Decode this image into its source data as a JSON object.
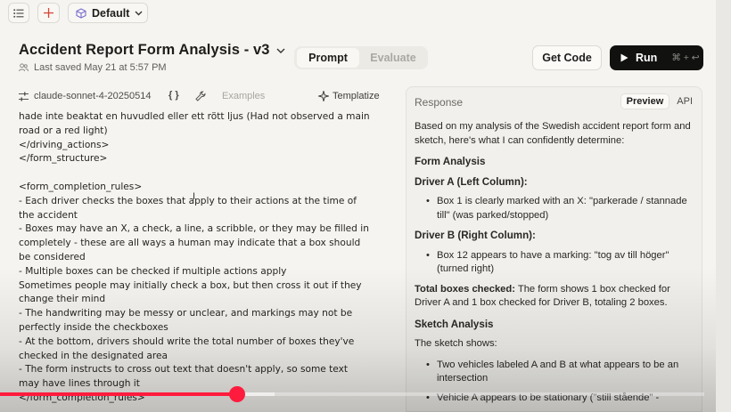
{
  "workspace": {
    "name": "Default"
  },
  "document": {
    "title": "Accident Report Form Analysis - v3",
    "last_saved": "Last saved May 21 at 5:57 PM"
  },
  "modes": {
    "prompt": "Prompt",
    "evaluate": "Evaluate"
  },
  "actions": {
    "get_code": "Get Code",
    "run": "Run",
    "run_shortcut": "⌘ + ↩"
  },
  "prompt_toolbar": {
    "model": "claude-sonnet-4-20250514",
    "variables_symbol": "{ }",
    "examples": "Examples",
    "templatize": "Templatize"
  },
  "prompt_lines": [
    "hade inte beaktat en huvudled eller ett rött ljus (Had not observed a main",
    "road or a red light)",
    "</driving_actions>",
    "</form_structure>",
    "",
    "<form_completion_rules>",
    "- Each driver checks the boxes that apply to their actions at the time of",
    "the accident",
    "- Boxes may have an X, a check, a line, a scribble, or they may be filled in",
    "completely - these are all ways a human may indicate that a box should",
    "be considered",
    "- Multiple boxes can be checked if multiple actions apply",
    "Sometimes people may initially check a box, but then cross it out if they",
    "change their mind",
    "- The handwriting may be messy or unclear, and markings may not be",
    "perfectly inside the checkboxes",
    "- At the bottom, drivers should write the total number of boxes they've",
    "checked in the designated area",
    "- The form instructs to cross out text that doesn't apply, so some text",
    "may have lines through it",
    "</form_completion_rules>"
  ],
  "response": {
    "header": "Response",
    "tab_preview": "Preview",
    "tab_api": "API",
    "intro": "Based on my analysis of the Swedish accident report form and sketch, here's what I can confidently determine:",
    "form_analysis_heading": "Form Analysis",
    "driver_a_heading": "Driver A (Left Column):",
    "driver_a_item": "Box 1 is clearly marked with an X: \"parkerade / stannade till\" (was parked/stopped)",
    "driver_b_heading": "Driver B (Right Column):",
    "driver_b_item": "Box 12 appears to have a marking: \"tog av till höger\" (turned right)",
    "total_label": "Total boxes checked:",
    "total_text": " The form shows 1 box checked for Driver A and 1 box checked for Driver B, totaling 2 boxes.",
    "sketch_heading": "Sketch Analysis",
    "sketch_intro": "The sketch shows:",
    "sketch_item_1": "Two vehicles labeled A and B at what appears to be an intersection",
    "sketch_item_2": "Vehicle A appears to be stationary (\"still stående\" -"
  },
  "video": {
    "played_fraction": 0.337,
    "buffered_fraction": 0.39
  }
}
